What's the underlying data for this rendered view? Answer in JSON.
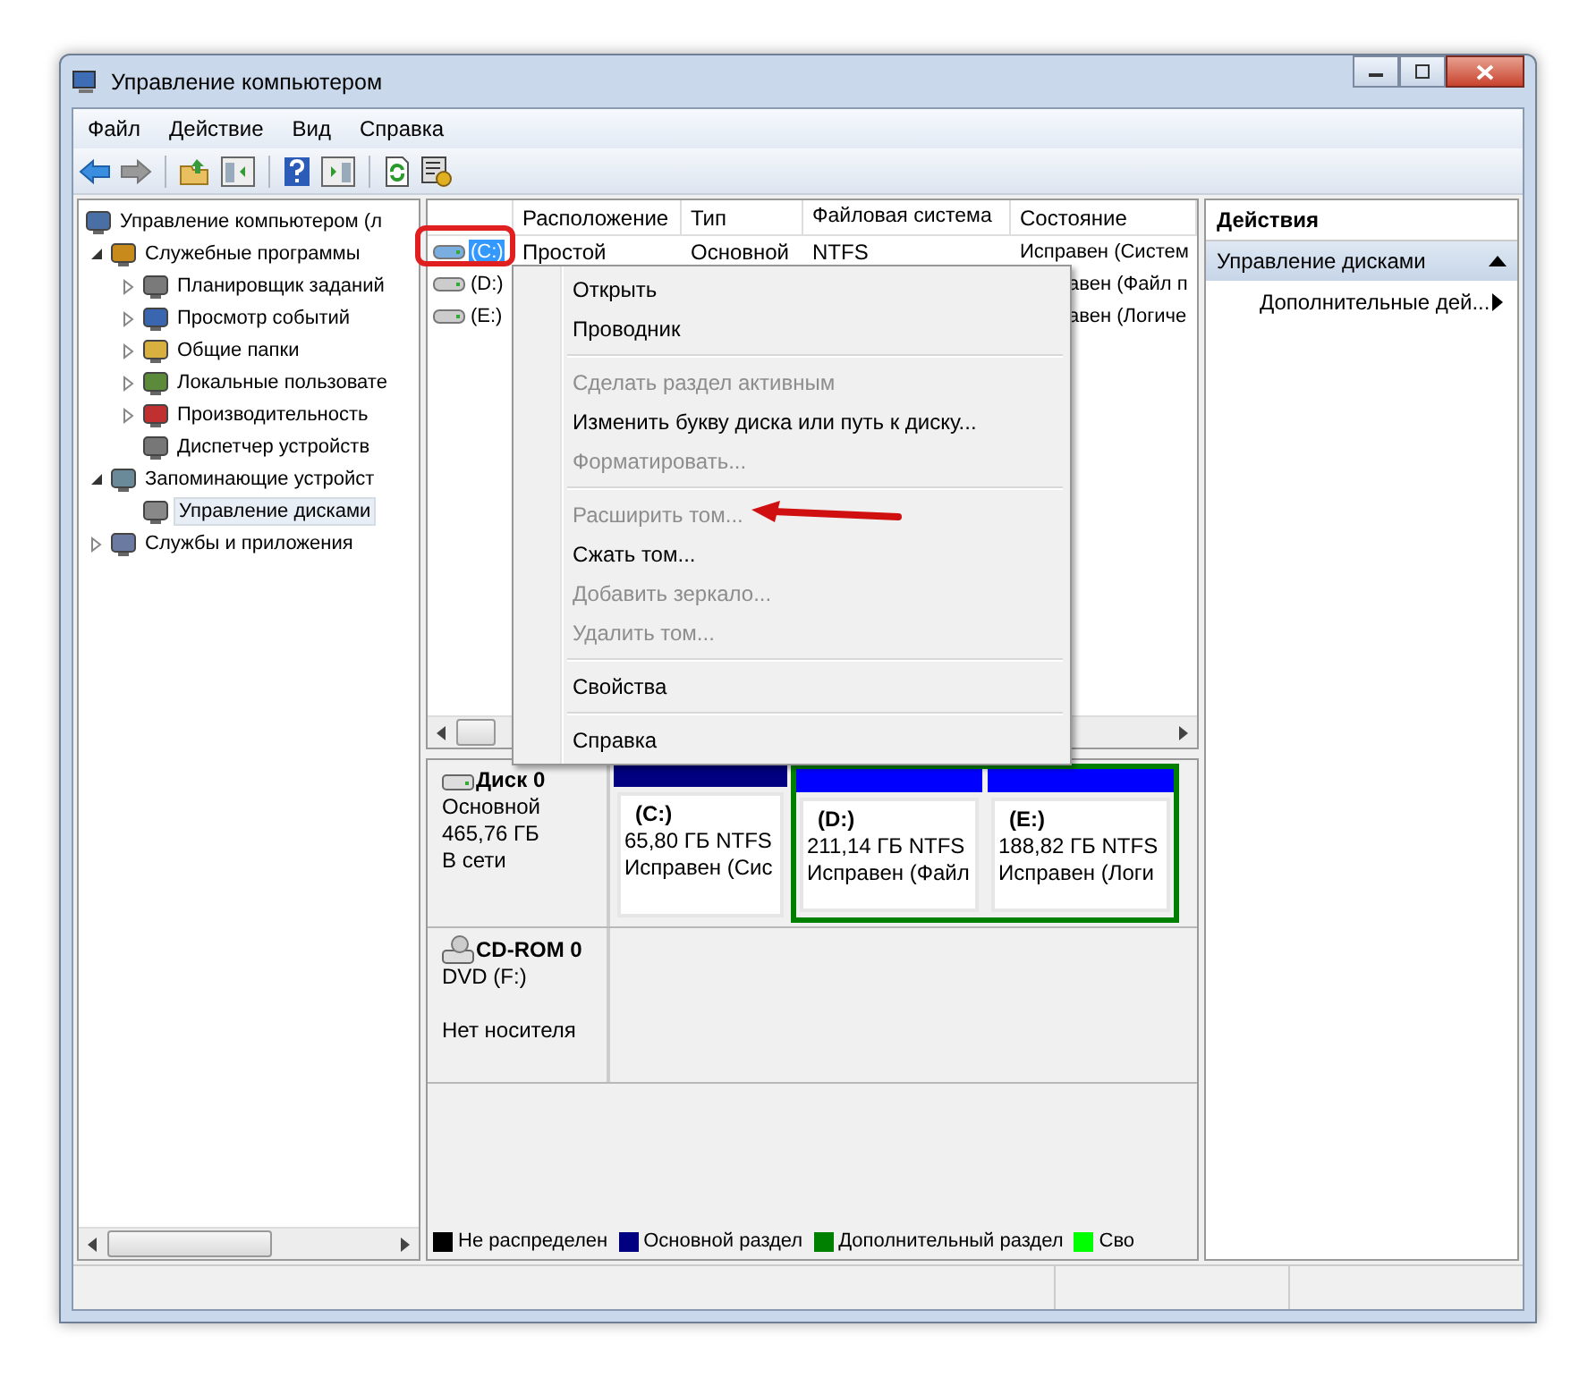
{
  "window": {
    "title": "Управление компьютером"
  },
  "menu": [
    "Файл",
    "Действие",
    "Вид",
    "Справка"
  ],
  "tree": [
    {
      "label": "Управление компьютером (л",
      "selected": false,
      "children": [
        {
          "label": "Служебные программы",
          "expanded": true,
          "selected": false,
          "children": [
            {
              "label": "Планировщик заданий",
              "expanded": false,
              "selected": false
            },
            {
              "label": "Просмотр событий",
              "expanded": false,
              "selected": false
            },
            {
              "label": "Общие папки",
              "expanded": false,
              "selected": false
            },
            {
              "label": "Локальные пользовате",
              "expanded": false,
              "selected": false
            },
            {
              "label": "Производительность",
              "expanded": false,
              "selected": false
            },
            {
              "label": "Диспетчер устройств",
              "selected": false
            }
          ]
        },
        {
          "label": "Запоминающие устройст",
          "expanded": true,
          "selected": false,
          "children": [
            {
              "label": "Управление дисками",
              "selected": true
            }
          ]
        },
        {
          "label": "Службы и приложения",
          "expanded": false,
          "selected": false
        }
      ]
    }
  ],
  "volumes": {
    "columns": [
      "Расположение",
      "Тип",
      "Файловая система",
      "Состояние"
    ],
    "rows": [
      {
        "volume": "(C:)",
        "layout": "Простой",
        "type": "Основной",
        "fs": "NTFS",
        "status": "Исправен (Систем",
        "selected": true
      },
      {
        "volume": "(D:)",
        "status": "авен (Файл п",
        "selected": false
      },
      {
        "volume": "(E:)",
        "status": "авен (Логиче",
        "selected": false
      }
    ]
  },
  "context_menu": [
    {
      "kind": "item",
      "label": "Открыть",
      "disabled": false
    },
    {
      "kind": "item",
      "label": "Проводник",
      "disabled": false
    },
    {
      "kind": "separator"
    },
    {
      "kind": "item",
      "label": "Сделать раздел активным",
      "disabled": true
    },
    {
      "kind": "item",
      "label": "Изменить букву диска или путь к диску...",
      "disabled": false
    },
    {
      "kind": "item",
      "label": "Форматировать...",
      "disabled": true
    },
    {
      "kind": "separator"
    },
    {
      "kind": "item",
      "label": "Расширить том...",
      "disabled": true
    },
    {
      "kind": "item",
      "label": "Сжать том...",
      "disabled": false
    },
    {
      "kind": "item",
      "label": "Добавить зеркало...",
      "disabled": true
    },
    {
      "kind": "item",
      "label": "Удалить том...",
      "disabled": true
    },
    {
      "kind": "separator"
    },
    {
      "kind": "item",
      "label": "Свойства",
      "disabled": false
    },
    {
      "kind": "separator"
    },
    {
      "kind": "item",
      "label": "Справка",
      "disabled": false
    }
  ],
  "disks": [
    {
      "kind": "disk",
      "name": "Диск 0",
      "lines": [
        "Основной",
        "465,76 ГБ",
        "В сети"
      ],
      "primary": [
        {
          "label": "(C:)",
          "size": "65,80 ГБ NTFS",
          "status": "Исправен (Сис",
          "color": "#000080"
        }
      ],
      "extended": {
        "color": "#008000",
        "partitions": [
          {
            "label": "(D:)",
            "size": "211,14 ГБ NTFS",
            "status": "Исправен (Файл",
            "color": "#0000ff"
          },
          {
            "label": "(E:)",
            "size": "188,82 ГБ NTFS",
            "status": "Исправен (Логи",
            "color": "#0000ff"
          }
        ]
      }
    },
    {
      "kind": "cdrom",
      "name": "CD-ROM 0",
      "lines": [
        "DVD (F:)",
        "Нет носителя"
      ]
    }
  ],
  "legend": [
    {
      "label": "Не распределен",
      "color": "#000000"
    },
    {
      "label": "Основной раздел",
      "color": "#000080"
    },
    {
      "label": "Дополнительный раздел",
      "color": "#008000"
    },
    {
      "label": "Сво",
      "color": "#00ff00"
    }
  ],
  "actions": {
    "title": "Действия",
    "section": "Управление дисками",
    "items": [
      "Дополнительные дей..."
    ]
  }
}
